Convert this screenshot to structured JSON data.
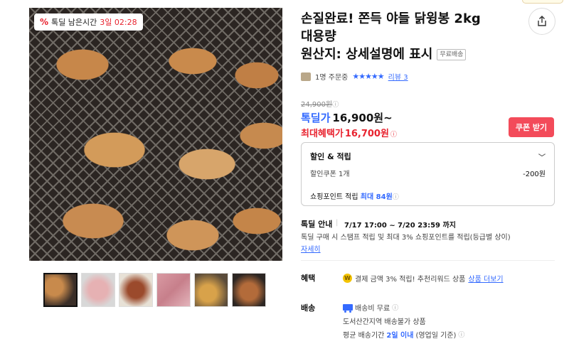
{
  "product": {
    "title_line1": "손질완료! 쫀득 야들 닭윙봉 2kg",
    "title_line2": "대용량",
    "title_line3": "원산지: 상세설명에 표시",
    "free_shipping_tag": "무료배송"
  },
  "image": {
    "timer_icon": "%",
    "timer_label": "톡딜 남은시간",
    "timer_value": "3일 02:28"
  },
  "thumbnails": [
    "thumb-1",
    "thumb-2",
    "thumb-3",
    "thumb-4",
    "thumb-5",
    "thumb-6"
  ],
  "meta": {
    "buyers": "1명 주문중",
    "stars": "★★★★★",
    "rating_fraction": 1.0,
    "reviews": "리뷰 3"
  },
  "price": {
    "original": "24,900원",
    "deal_label": "톡딜가",
    "deal_price": "16,900원~",
    "max_label": "최대혜택가",
    "max_price": "16,700원",
    "info_glyph": "ⓘ"
  },
  "coupon": {
    "label": "쿠폰 받기"
  },
  "discount": {
    "header": "할인 & 적립",
    "chevron": "﹀",
    "coupon_label": "할인쿠폰 1개",
    "coupon_amount": "-200원",
    "points_prefix": "쇼핑포인트 적립",
    "points_value": "최대 84원"
  },
  "deal": {
    "label": "톡딜 안내",
    "separator": "|",
    "period": "7/17 17:00 ~ 7/20 23:59 까지",
    "desc": "톡딜 구매 시 스탬프 적립 및 최대 3% 쇼핑포인트를 적립(등급별 상이)",
    "detail_link": "자세히"
  },
  "benefit": {
    "label": "혜택",
    "coin": "W",
    "text": "결제 금액 3% 적립! 추천리워드 상품",
    "link": "상품 더보기"
  },
  "shipping": {
    "label": "배송",
    "fee": "배송비 무료",
    "restriction": "도서산간지역 배송불가 상품",
    "avg_prefix": "평균 배송기간",
    "avg_days": "2일 이내",
    "avg_suffix": "(영업일 기준)"
  },
  "colors": {
    "accent_blue": "#346aff",
    "accent_red": "#e8232f",
    "coupon_bg": "#f34b5a"
  }
}
